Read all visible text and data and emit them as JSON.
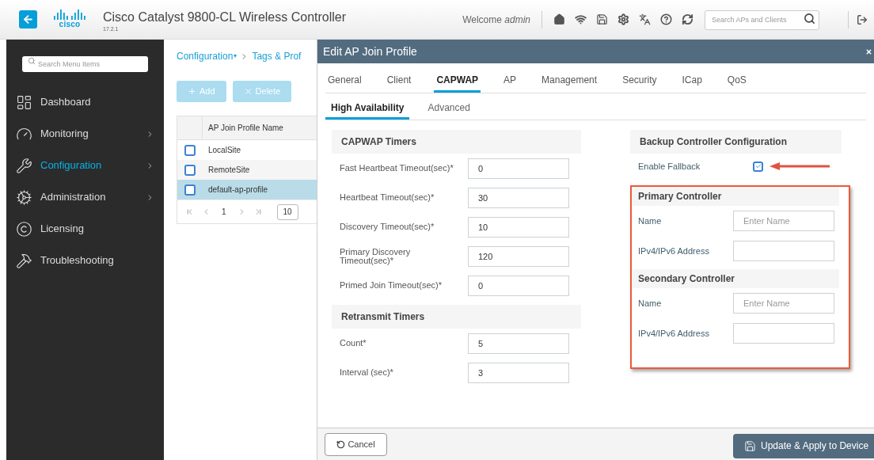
{
  "header": {
    "logo_text": "cisco",
    "title": "Cisco Catalyst 9800-CL Wireless Controller",
    "version": "17.2.1",
    "welcome": "Welcome *admin*",
    "search": {
      "placeholder": "Search APs and Clients"
    }
  },
  "sidebar": {
    "search": {
      "placeholder": "Search Menu Items"
    },
    "items": [
      {
        "label": "Dashboard",
        "selected": false,
        "has_submenu": false
      },
      {
        "label": "Monitoring",
        "selected": false,
        "has_submenu": true
      },
      {
        "label": "Configuration",
        "selected": true,
        "has_submenu": true
      },
      {
        "label": "Administration",
        "selected": false,
        "has_submenu": true
      },
      {
        "label": "Licensing",
        "selected": false,
        "has_submenu": false
      },
      {
        "label": "Troubleshooting",
        "selected": false,
        "has_submenu": false
      }
    ]
  },
  "content": {
    "breadcrumb": [
      "Configuration",
      "Tags & Prof"
    ],
    "breadcrumb_caret": "▾",
    "buttons": [
      {
        "label": "Add",
        "disabled": true
      },
      {
        "label": "Delete",
        "disabled": true
      }
    ],
    "table": {
      "columns": [
        "AP Join Profile Name"
      ],
      "rows": [
        {
          "name": "LocalSite",
          "checked": false,
          "selected": false
        },
        {
          "name": "RemoteSite",
          "checked": false,
          "selected": false
        },
        {
          "name": "default-ap-profile",
          "checked": false,
          "selected": true
        }
      ]
    },
    "pagination": {
      "page": "1",
      "page_size": "10"
    }
  },
  "panel": {
    "title": "Edit AP Join Profile",
    "tabs": [
      {
        "label": "General",
        "selected": false
      },
      {
        "label": "Client",
        "selected": false
      },
      {
        "label": "CAPWAP",
        "selected": true
      },
      {
        "label": "AP",
        "selected": false
      },
      {
        "label": "Management",
        "selected": false
      },
      {
        "label": "Security",
        "selected": false
      },
      {
        "label": "ICap",
        "selected": false
      },
      {
        "label": "QoS",
        "selected": false
      }
    ],
    "subtabs": [
      {
        "label": "High Availability",
        "selected": true
      },
      {
        "label": "Advanced",
        "selected": false
      }
    ],
    "left_sections": [
      {
        "title": "CAPWAP Timers",
        "fields": [
          {
            "label": "Fast Heartbeat Timeout(sec)*",
            "value": "0"
          },
          {
            "label": "Heartbeat Timeout(sec)*",
            "value": "30"
          },
          {
            "label": "Discovery Timeout(sec)*",
            "value": "10"
          },
          {
            "label": "Primary Discovery Timeout(sec)*",
            "value": "120"
          },
          {
            "label": "Primed Join Timeout(sec)*",
            "value": "0"
          }
        ]
      },
      {
        "title": "Retransmit Timers",
        "fields": [
          {
            "label": "Count*",
            "value": "5"
          },
          {
            "label": "Interval (sec)*",
            "value": "3"
          }
        ]
      }
    ],
    "backup": {
      "title": "Backup Controller Configuration",
      "fallback": {
        "label": "Enable Fallback",
        "checked": true
      },
      "controllers": [
        {
          "title": "Primary Controller",
          "fields": [
            {
              "label": "Name",
              "placeholder": "Enter Name"
            },
            {
              "label": "IPv4/IPv6 Address"
            }
          ]
        },
        {
          "title": "Secondary Controller",
          "fields": [
            {
              "label": "Name",
              "placeholder": "Enter Name"
            },
            {
              "label": "IPv4/IPv6 Address"
            }
          ]
        }
      ]
    },
    "footer": {
      "cancel": "Cancel",
      "apply": "Update & Apply to Device"
    }
  }
}
